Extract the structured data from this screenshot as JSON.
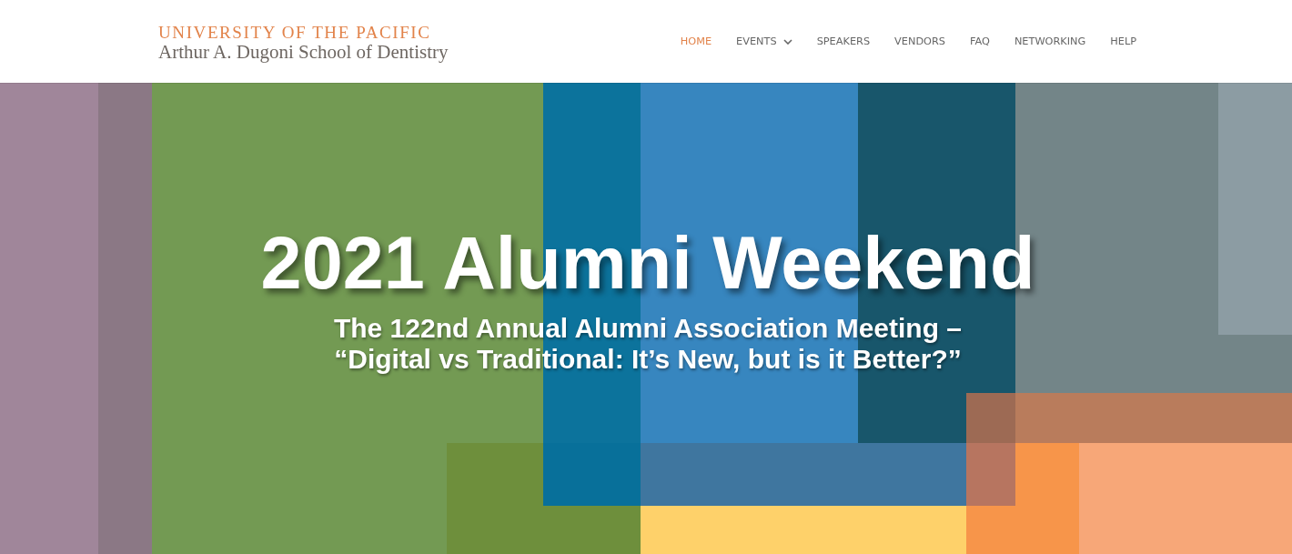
{
  "header": {
    "logo": {
      "line_1": "UNIVERSITY OF THE PACIFIC",
      "line_2": "Arthur A. Dugoni School of Dentistry"
    },
    "nav": [
      {
        "label": "HOME",
        "selected": true,
        "dropdown": false
      },
      {
        "label": "EVENTS",
        "selected": false,
        "dropdown": true
      },
      {
        "label": "SPEAKERS",
        "selected": false,
        "dropdown": false
      },
      {
        "label": "VENDORS",
        "selected": false,
        "dropdown": false
      },
      {
        "label": "FAQ",
        "selected": false,
        "dropdown": false
      },
      {
        "label": "NETWORKING",
        "selected": false,
        "dropdown": false
      },
      {
        "label": "HELP",
        "selected": false,
        "dropdown": false
      }
    ]
  },
  "hero": {
    "title": "2021 Alumni Weekend",
    "subtitle": "The 122nd Annual Alumni Association Meeting –\n“Digital vs Traditional: It’s New, but is it Better?”"
  }
}
